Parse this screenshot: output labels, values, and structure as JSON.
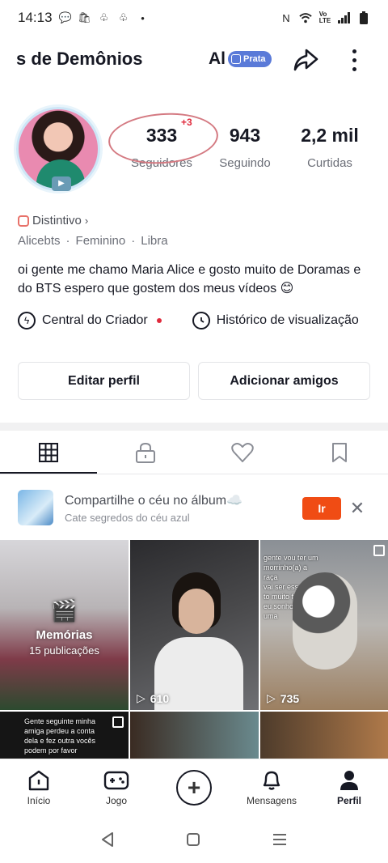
{
  "statusbar": {
    "time": "14:13"
  },
  "header": {
    "username": "s de Demônios",
    "second_user": "Al",
    "badge": "Prata"
  },
  "stats": {
    "followers": {
      "value": "333",
      "label": "Seguidores",
      "delta": "+3"
    },
    "following": {
      "value": "943",
      "label": "Seguindo"
    },
    "likes": {
      "value": "2,2 mil",
      "label": "Curtidas"
    }
  },
  "profile": {
    "distintivo": "Distintivo",
    "info": [
      "Alicebts",
      "Feminino",
      "Libra"
    ],
    "bio": "oi gente me chamo Maria Alice e gosto muito de Doramas e do BTS espero que gostem dos meus vídeos 😊"
  },
  "links": {
    "creator_center": "Central do Criador",
    "watch_history": "Histórico de visualização"
  },
  "buttons": {
    "edit_profile": "Editar perfil",
    "add_friends": "Adicionar amigos"
  },
  "album": {
    "title": "Compartilhe o céu no álbum☁️",
    "subtitle": "Cate segredos do céu azul",
    "go": "Ir"
  },
  "grid": {
    "memories_title": "Memórias",
    "memories_sub": "15 publicações",
    "views_2": "610",
    "views_3": "735",
    "overlay_3": "gente vou ter um morrinho(a) a raça\nvai ser essa do\nto muito feliz e\neu sonho ter uma",
    "overlay_4": "Gente seguinte minha\namiga perdeu a conta\ndela e fez outra vocês\npodem por favor"
  },
  "bottomnav": {
    "home": "Início",
    "game": "Jogo",
    "messages": "Mensagens",
    "profile": "Perfil"
  }
}
